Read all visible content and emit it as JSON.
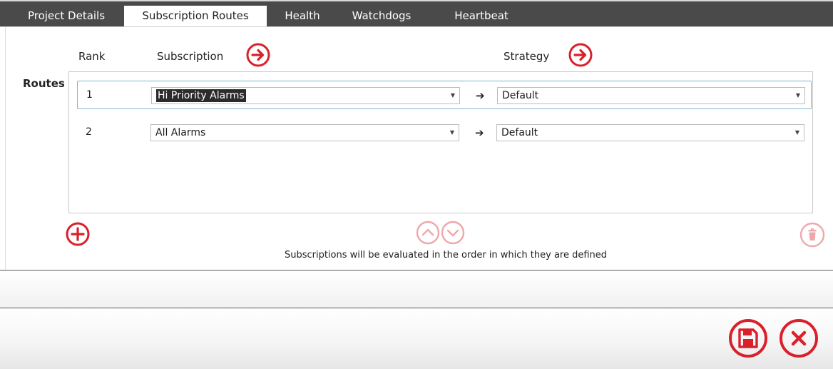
{
  "tabs": [
    {
      "label": "Project Details",
      "active": false
    },
    {
      "label": "Subscription Routes",
      "active": true
    },
    {
      "label": "Health",
      "active": false
    },
    {
      "label": "Watchdogs",
      "active": false
    },
    {
      "label": "Heartbeat",
      "active": false
    }
  ],
  "columns": {
    "rank": "Rank",
    "subscription": "Subscription",
    "strategy": "Strategy"
  },
  "routes_label": "Routes",
  "routes": [
    {
      "rank": "1",
      "subscription": "Hi Priority Alarms",
      "strategy": "Default",
      "selected": true
    },
    {
      "rank": "2",
      "subscription": "All Alarms",
      "strategy": "Default",
      "selected": false
    }
  ],
  "flow_arrow": "➔",
  "hint": "Subscriptions will be evaluated in the order in which they are defined",
  "icons": {
    "subscription_nav": "arrow-right-circle-icon",
    "strategy_nav": "arrow-right-circle-icon",
    "add": "plus-circle-icon",
    "move_up": "chevron-up-circle-icon",
    "move_down": "chevron-down-circle-icon",
    "delete": "trash-circle-icon",
    "save": "save-circle-icon",
    "close": "close-circle-icon"
  },
  "colors": {
    "accent": "#d9202b",
    "accent_disabled": "#efa7ab",
    "tabbar": "#4a4a4a",
    "selection_border": "#7fb6d6"
  }
}
